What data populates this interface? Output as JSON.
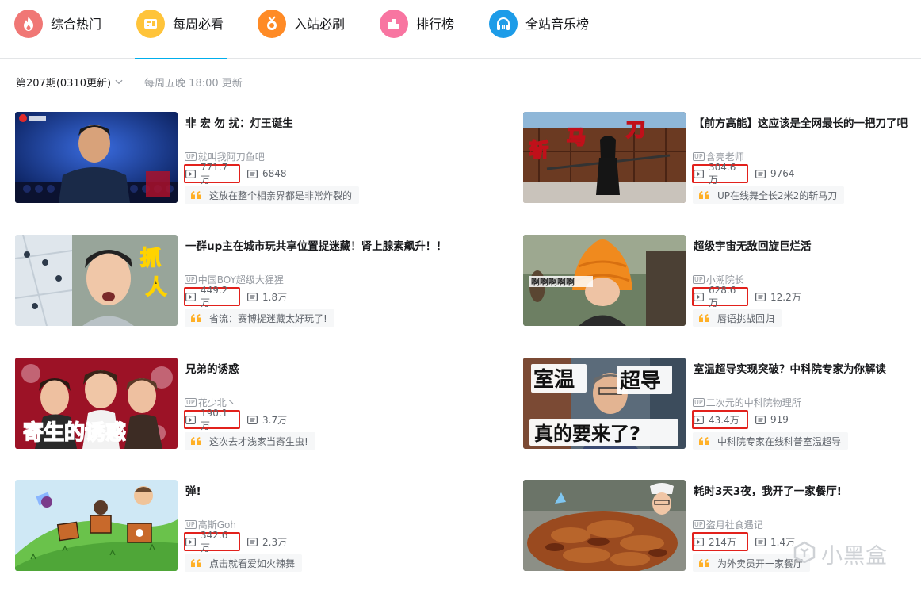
{
  "tabs": [
    {
      "label": "综合热门",
      "icon": "flame-icon",
      "color": "#f07775"
    },
    {
      "label": "每周必看",
      "icon": "calendar-card-icon",
      "color": "#ffc43a",
      "active": true
    },
    {
      "label": "入站必刷",
      "icon": "medal-icon",
      "color": "#ff8b26"
    },
    {
      "label": "排行榜",
      "icon": "bar-chart-icon",
      "color": "#f875a1"
    },
    {
      "label": "全站音乐榜",
      "icon": "headphones-icon",
      "color": "#1d9ce8"
    }
  ],
  "issue": {
    "selected": "第207期(0310更新)",
    "note": "每周五晚 18:00 更新"
  },
  "accent": "#00aeec",
  "highlight_box_color": "#e2211c",
  "videos": [
    {
      "title": "非 宏 勿 扰：灯王诞生",
      "up": "就叫我阿刀鱼吧",
      "plays": "771.7万",
      "danmaku": "6848",
      "reason": "这放在整个相亲界都是非常炸裂的"
    },
    {
      "title": "【前方高能】这应该是全网最长的一把刀了吧",
      "up": "含亮老师",
      "plays": "304.6万",
      "danmaku": "9764",
      "reason": "UP在线舞全长2米2的斩马刀",
      "thumb_text": [
        "斩",
        "马",
        "刀"
      ]
    },
    {
      "title": "一群up主在城市玩共享位置捉迷藏！肾上腺素飙升！！",
      "up": "中国BOY超级大猩猩",
      "plays": "449.2万",
      "danmaku": "1.8万",
      "reason": "省流：赛博捉迷藏太好玩了!",
      "thumb_text": [
        "抓",
        "人"
      ]
    },
    {
      "title": "超级宇宙无敌回旋巨烂活",
      "up": "小潮院长",
      "plays": "628.6万",
      "danmaku": "12.2万",
      "reason": "唇语挑战回归",
      "thumb_text": [
        "啊啊啊啊啊"
      ]
    },
    {
      "title": "兄弟的诱惑",
      "up": "花少北丶",
      "plays": "190.1万",
      "danmaku": "3.7万",
      "reason": "这次去才浅家当寄生虫!",
      "thumb_text": [
        "寄生的诱惑"
      ]
    },
    {
      "title": "室温超导实现突破？中科院专家为你解读",
      "up": "二次元的中科院物理所",
      "plays": "43.4万",
      "danmaku": "919",
      "reason": "中科院专家在线科普室温超导",
      "thumb_text": [
        "室温",
        "超导",
        "真的要来了?"
      ]
    },
    {
      "title": "弹!",
      "up": "高斯Goh",
      "plays": "342.6万",
      "danmaku": "2.3万",
      "reason": "点击就看爱如火辣舞"
    },
    {
      "title": "耗时3天3夜，我开了一家餐厅!",
      "up": "盗月社食遇记",
      "plays": "214万",
      "danmaku": "1.4万",
      "reason": "为外卖员开一家餐厅"
    }
  ],
  "up_badge": "UP",
  "watermark": "小黑盒"
}
